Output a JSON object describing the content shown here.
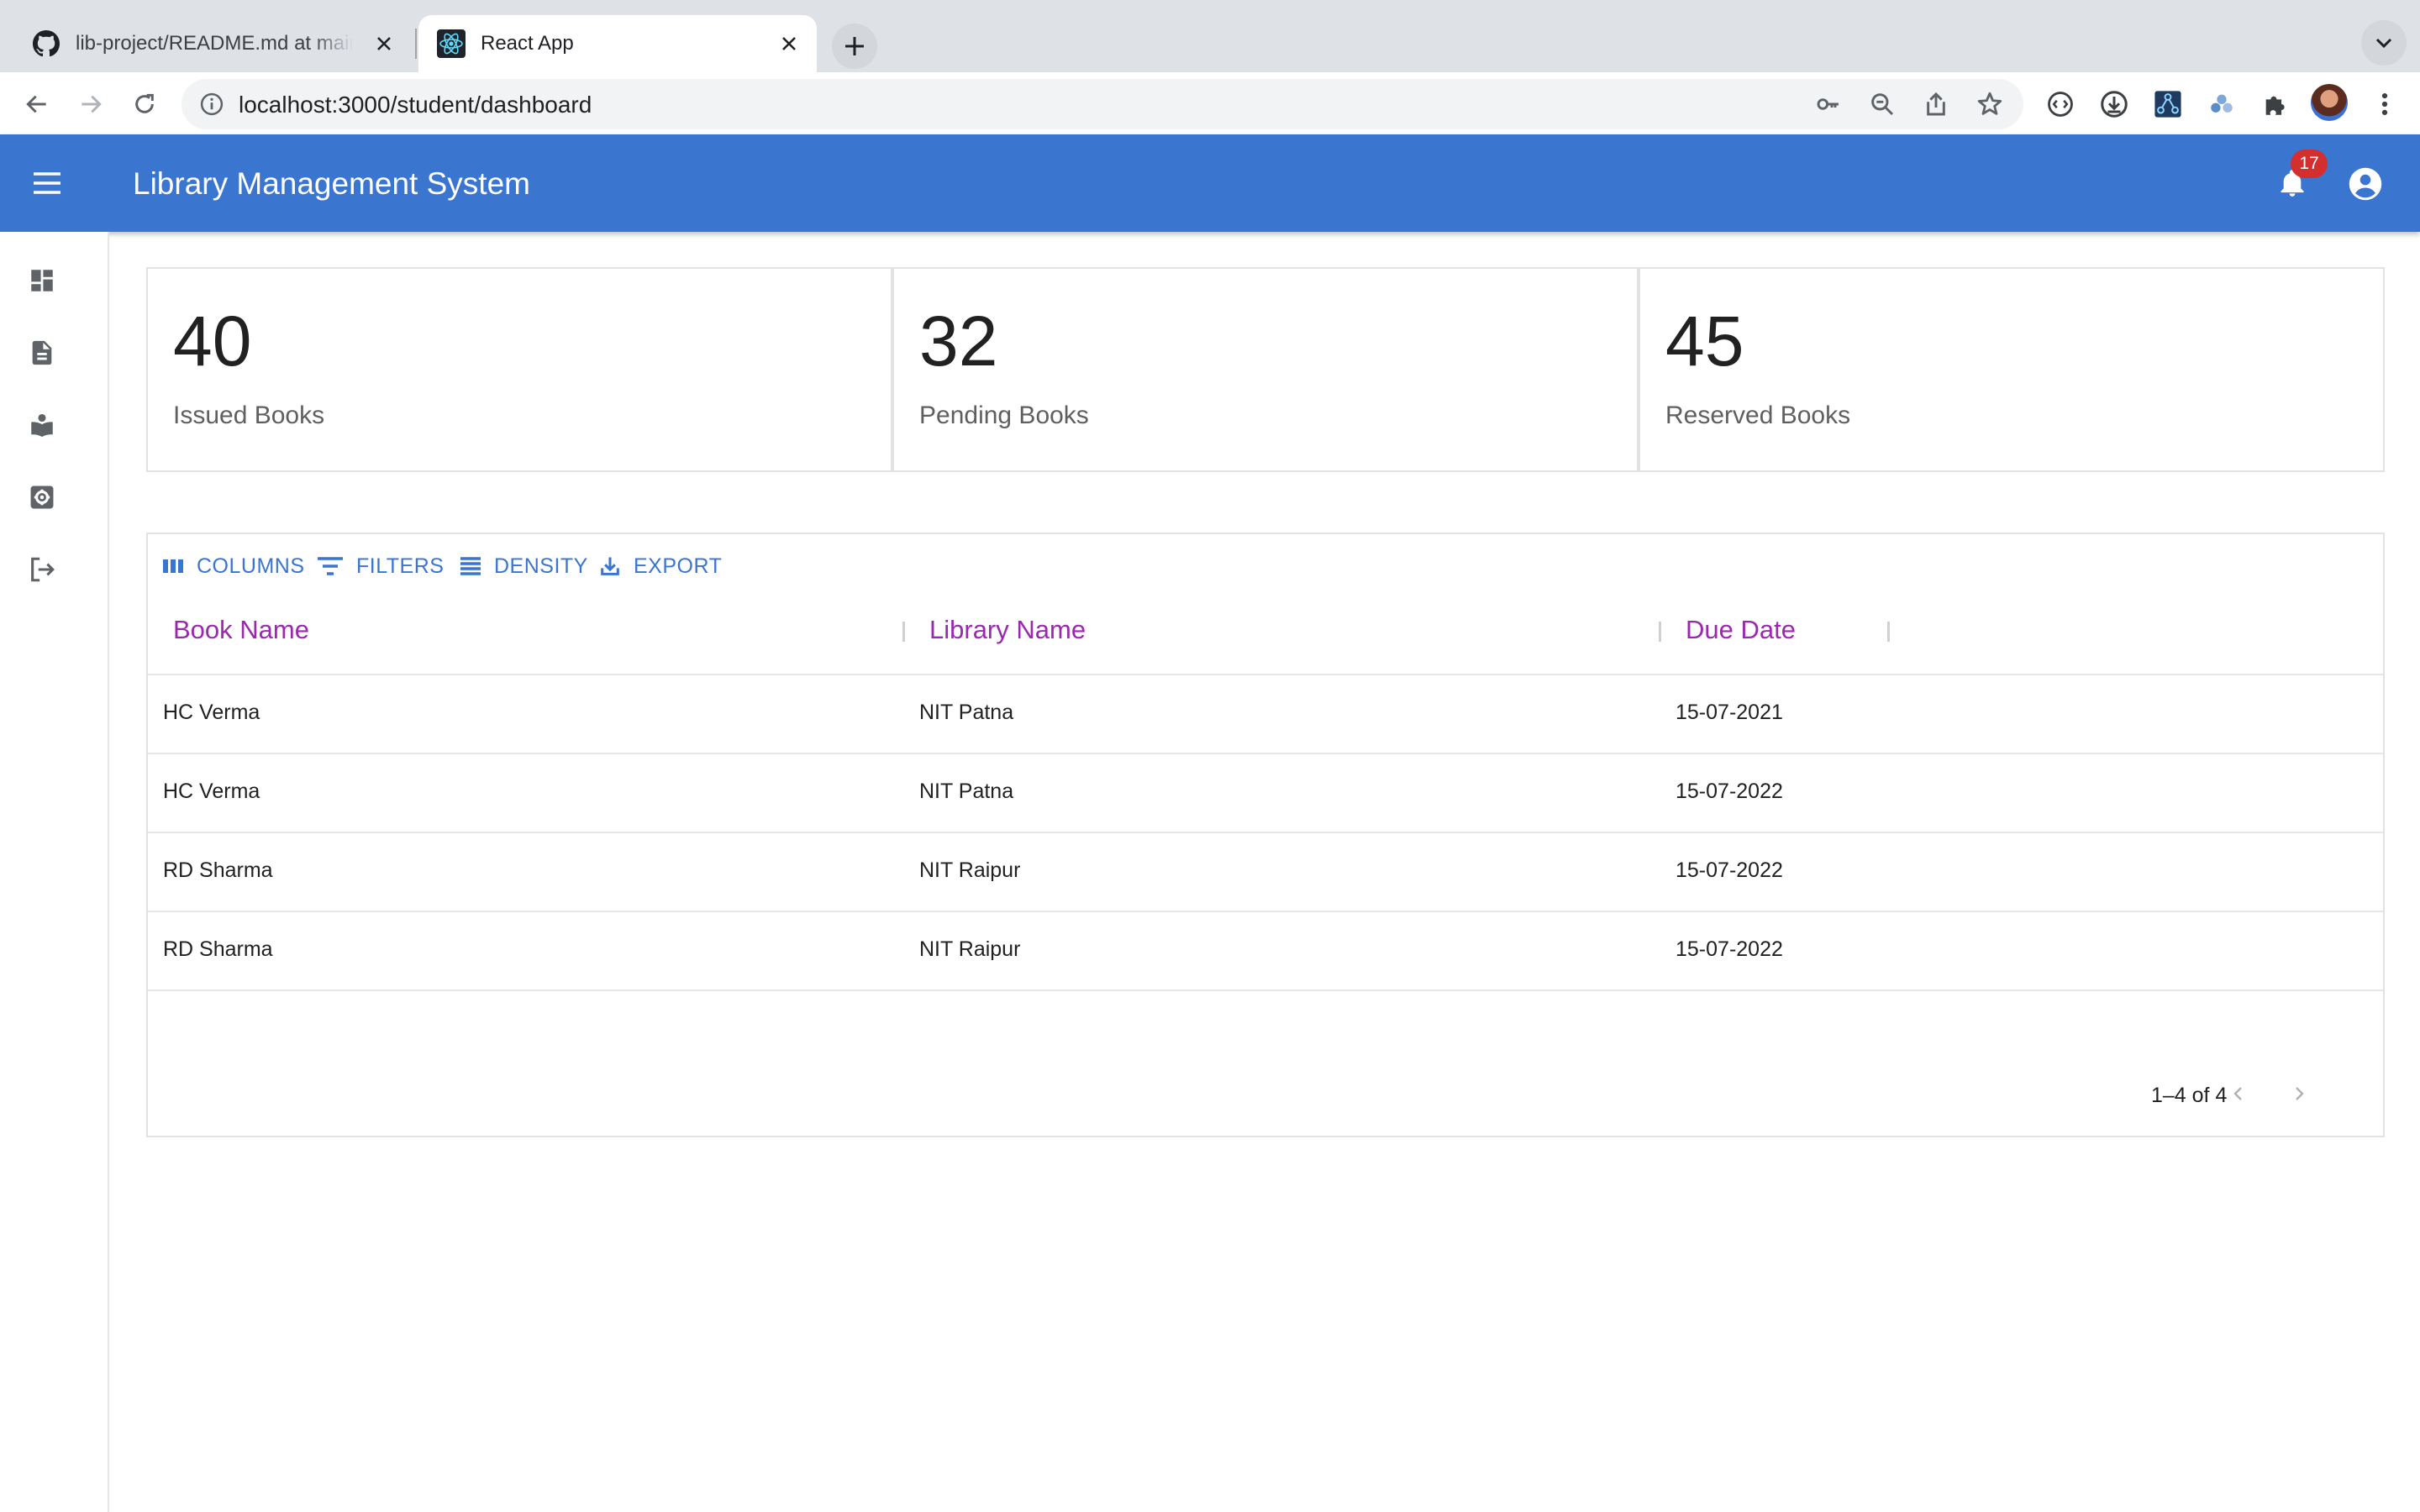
{
  "browser": {
    "tabs": [
      {
        "title": "lib-project/README.md at main",
        "icon": "github-icon",
        "active": false
      },
      {
        "title": "React App",
        "icon": "react-icon",
        "active": true
      }
    ],
    "url": "localhost:3000/student/dashboard"
  },
  "appbar": {
    "title": "Library Management System",
    "notification_count": "17",
    "accent_color": "#3a75d0"
  },
  "sidebar": {
    "items": [
      {
        "icon": "dashboard-icon"
      },
      {
        "icon": "document-icon"
      },
      {
        "icon": "book-reader-icon"
      },
      {
        "icon": "settings-icon"
      },
      {
        "icon": "logout-icon"
      }
    ]
  },
  "stats": [
    {
      "value": "40",
      "label": "Issued Books"
    },
    {
      "value": "32",
      "label": "Pending Books"
    },
    {
      "value": "45",
      "label": "Reserved Books"
    }
  ],
  "grid": {
    "toolbar": {
      "columns": "COLUMNS",
      "filters": "FILTERS",
      "density": "DENSITY",
      "export": "EXPORT"
    },
    "headers": [
      "Book Name",
      "Library Name",
      "Due Date"
    ],
    "header_color": "#9c27b0",
    "rows": [
      [
        "HC Verma",
        "NIT Patna",
        "15-07-2021"
      ],
      [
        "HC Verma",
        "NIT Patna",
        "15-07-2022"
      ],
      [
        "RD Sharma",
        "NIT Raipur",
        "15-07-2022"
      ],
      [
        "RD Sharma",
        "NIT Raipur",
        "15-07-2022"
      ]
    ],
    "pagination": "1–4 of 4"
  }
}
